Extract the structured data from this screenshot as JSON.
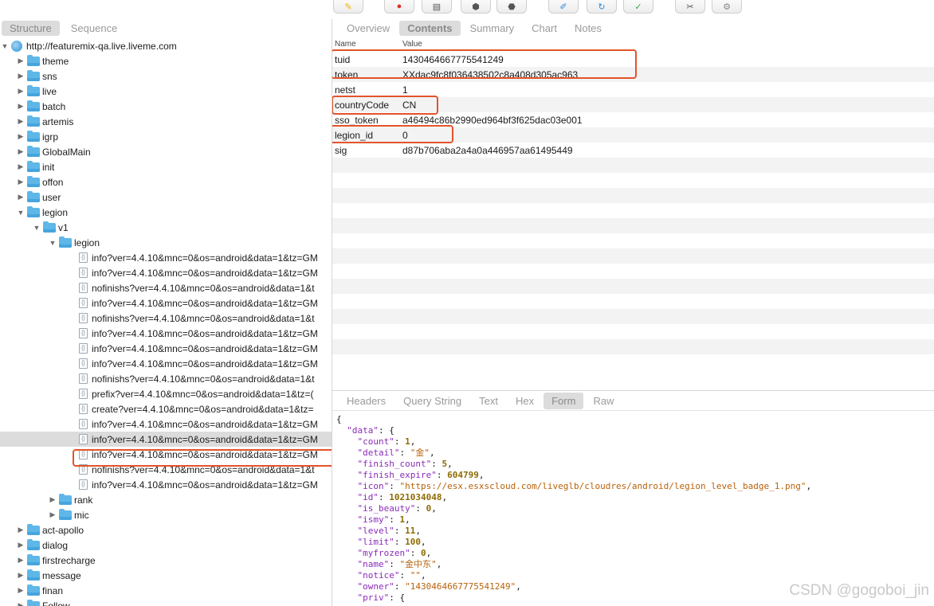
{
  "toolbar": {
    "buttons": [
      {
        "name": "highlight-tool",
        "glyph": "✎",
        "color": "#f2b300"
      },
      {
        "name": "record",
        "glyph": "●",
        "color": "#e0302a"
      },
      {
        "name": "throttle",
        "glyph": "▤",
        "color": "#555"
      },
      {
        "name": "breakpoints",
        "glyph": "⬢",
        "color": "#555"
      },
      {
        "name": "stop",
        "glyph": "⬣",
        "color": "#555"
      },
      {
        "name": "compose",
        "glyph": "✐",
        "color": "#2f8bd8"
      },
      {
        "name": "repeat",
        "glyph": "↻",
        "color": "#2f8bd8"
      },
      {
        "name": "validate",
        "glyph": "✓",
        "color": "#2fa84a"
      },
      {
        "name": "tools",
        "glyph": "✂",
        "color": "#555"
      },
      {
        "name": "settings",
        "glyph": "⚙",
        "color": "#888"
      }
    ]
  },
  "left": {
    "tabs": [
      "Structure",
      "Sequence"
    ],
    "host": "http://featuremix-qa.live.liveme.com",
    "tree": [
      {
        "label": "theme",
        "level": 1,
        "type": "folder",
        "open": false
      },
      {
        "label": "sns",
        "level": 1,
        "type": "folder",
        "open": false
      },
      {
        "label": "live",
        "level": 1,
        "type": "folder",
        "open": false
      },
      {
        "label": "batch",
        "level": 1,
        "type": "folder",
        "open": false
      },
      {
        "label": "artemis",
        "level": 1,
        "type": "folder",
        "open": false
      },
      {
        "label": "igrp",
        "level": 1,
        "type": "folder",
        "open": false
      },
      {
        "label": "GlobalMain",
        "level": 1,
        "type": "folder",
        "open": false
      },
      {
        "label": "init",
        "level": 1,
        "type": "folder",
        "open": false
      },
      {
        "label": "offon",
        "level": 1,
        "type": "folder",
        "open": false
      },
      {
        "label": "user",
        "level": 1,
        "type": "folder",
        "open": false
      },
      {
        "label": "legion",
        "level": 1,
        "type": "folder",
        "open": true
      },
      {
        "label": "v1",
        "level": 2,
        "type": "folder",
        "open": true
      },
      {
        "label": "legion",
        "level": 3,
        "type": "folder",
        "open": true
      },
      {
        "label": "info?ver=4.4.10&mnc=0&os=android&data=1&tz=GM",
        "level": 4,
        "type": "doc"
      },
      {
        "label": "info?ver=4.4.10&mnc=0&os=android&data=1&tz=GM",
        "level": 4,
        "type": "doc"
      },
      {
        "label": "nofinishs?ver=4.4.10&mnc=0&os=android&data=1&t",
        "level": 4,
        "type": "doc"
      },
      {
        "label": "info?ver=4.4.10&mnc=0&os=android&data=1&tz=GM",
        "level": 4,
        "type": "doc"
      },
      {
        "label": "nofinishs?ver=4.4.10&mnc=0&os=android&data=1&t",
        "level": 4,
        "type": "doc"
      },
      {
        "label": "info?ver=4.4.10&mnc=0&os=android&data=1&tz=GM",
        "level": 4,
        "type": "doc"
      },
      {
        "label": "info?ver=4.4.10&mnc=0&os=android&data=1&tz=GM",
        "level": 4,
        "type": "doc"
      },
      {
        "label": "info?ver=4.4.10&mnc=0&os=android&data=1&tz=GM",
        "level": 4,
        "type": "doc"
      },
      {
        "label": "nofinishs?ver=4.4.10&mnc=0&os=android&data=1&t",
        "level": 4,
        "type": "doc"
      },
      {
        "label": "prefix?ver=4.4.10&mnc=0&os=android&data=1&tz=(",
        "level": 4,
        "type": "doc"
      },
      {
        "label": "create?ver=4.4.10&mnc=0&os=android&data=1&tz=",
        "level": 4,
        "type": "doc"
      },
      {
        "label": "info?ver=4.4.10&mnc=0&os=android&data=1&tz=GM",
        "level": 4,
        "type": "doc"
      },
      {
        "label": "info?ver=4.4.10&mnc=0&os=android&data=1&tz=GM",
        "level": 4,
        "type": "doc",
        "selected": true
      },
      {
        "label": "info?ver=4.4.10&mnc=0&os=android&data=1&tz=GM",
        "level": 4,
        "type": "doc"
      },
      {
        "label": "nofinishs?ver=4.4.10&mnc=0&os=android&data=1&t",
        "level": 4,
        "type": "doc"
      },
      {
        "label": "info?ver=4.4.10&mnc=0&os=android&data=1&tz=GM",
        "level": 4,
        "type": "doc"
      },
      {
        "label": "rank",
        "level": 3,
        "type": "folder",
        "open": false
      },
      {
        "label": "mic",
        "level": 3,
        "type": "folder",
        "open": false
      },
      {
        "label": "act-apollo",
        "level": 1,
        "type": "folder",
        "open": false
      },
      {
        "label": "dialog",
        "level": 1,
        "type": "folder",
        "open": false
      },
      {
        "label": "firstrecharge",
        "level": 1,
        "type": "folder",
        "open": false
      },
      {
        "label": "message",
        "level": 1,
        "type": "folder",
        "open": false
      },
      {
        "label": "finan",
        "level": 1,
        "type": "folder",
        "open": false
      },
      {
        "label": "Follow",
        "level": 1,
        "type": "folder",
        "open": false
      }
    ]
  },
  "right": {
    "tabs": [
      "Overview",
      "Contents",
      "Summary",
      "Chart",
      "Notes"
    ],
    "active_tab": "Contents",
    "col_name": "Name",
    "col_value": "Value",
    "params": [
      {
        "key": "tuid",
        "value": "1430464667775541249"
      },
      {
        "key": "token",
        "value": "XXdac9fc8f036438502c8a408d305ac963"
      },
      {
        "key": "netst",
        "value": "1"
      },
      {
        "key": "countryCode",
        "value": "CN"
      },
      {
        "key": "sso_token",
        "value": "a46494c86b2990ed964bf3f625dac03e001"
      },
      {
        "key": "legion_id",
        "value": "0"
      },
      {
        "key": "sig",
        "value": "d87b706aba2a4a0a446957aa61495449"
      }
    ],
    "bottom_tabs": [
      "Headers",
      "Query String",
      "Text",
      "Hex",
      "Form",
      "Raw"
    ],
    "bottom_active": "Form",
    "json_lines": [
      {
        "indent": 0,
        "parts": [
          [
            "p",
            "{"
          ]
        ]
      },
      {
        "indent": 1,
        "parts": [
          [
            "k",
            "\"data\""
          ],
          [
            "p",
            ": {"
          ]
        ]
      },
      {
        "indent": 2,
        "parts": [
          [
            "k",
            "\"count\""
          ],
          [
            "p",
            ": "
          ],
          [
            "n",
            "1"
          ],
          [
            "p",
            ","
          ]
        ]
      },
      {
        "indent": 2,
        "parts": [
          [
            "k",
            "\"detail\""
          ],
          [
            "p",
            ": "
          ],
          [
            "s",
            "\"金\""
          ],
          [
            "p",
            ","
          ]
        ]
      },
      {
        "indent": 2,
        "parts": [
          [
            "k",
            "\"finish_count\""
          ],
          [
            "p",
            ": "
          ],
          [
            "n",
            "5"
          ],
          [
            "p",
            ","
          ]
        ]
      },
      {
        "indent": 2,
        "parts": [
          [
            "k",
            "\"finish_expire\""
          ],
          [
            "p",
            ": "
          ],
          [
            "n",
            "604799"
          ],
          [
            "p",
            ","
          ]
        ]
      },
      {
        "indent": 2,
        "parts": [
          [
            "k",
            "\"icon\""
          ],
          [
            "p",
            ": "
          ],
          [
            "s",
            "\"https://esx.esxscloud.com/liveglb/cloudres/android/legion_level_badge_1.png\""
          ],
          [
            "p",
            ","
          ]
        ]
      },
      {
        "indent": 2,
        "parts": [
          [
            "k",
            "\"id\""
          ],
          [
            "p",
            ": "
          ],
          [
            "n",
            "1021034048"
          ],
          [
            "p",
            ","
          ]
        ]
      },
      {
        "indent": 2,
        "parts": [
          [
            "k",
            "\"is_beauty\""
          ],
          [
            "p",
            ": "
          ],
          [
            "n",
            "0"
          ],
          [
            "p",
            ","
          ]
        ]
      },
      {
        "indent": 2,
        "parts": [
          [
            "k",
            "\"ismy\""
          ],
          [
            "p",
            ": "
          ],
          [
            "n",
            "1"
          ],
          [
            "p",
            ","
          ]
        ]
      },
      {
        "indent": 2,
        "parts": [
          [
            "k",
            "\"level\""
          ],
          [
            "p",
            ": "
          ],
          [
            "n",
            "11"
          ],
          [
            "p",
            ","
          ]
        ]
      },
      {
        "indent": 2,
        "parts": [
          [
            "k",
            "\"limit\""
          ],
          [
            "p",
            ": "
          ],
          [
            "n",
            "100"
          ],
          [
            "p",
            ","
          ]
        ]
      },
      {
        "indent": 2,
        "parts": [
          [
            "k",
            "\"myfrozen\""
          ],
          [
            "p",
            ": "
          ],
          [
            "n",
            "0"
          ],
          [
            "p",
            ","
          ]
        ]
      },
      {
        "indent": 2,
        "parts": [
          [
            "k",
            "\"name\""
          ],
          [
            "p",
            ": "
          ],
          [
            "s",
            "\"金中东\""
          ],
          [
            "p",
            ","
          ]
        ]
      },
      {
        "indent": 2,
        "parts": [
          [
            "k",
            "\"notice\""
          ],
          [
            "p",
            ": "
          ],
          [
            "s",
            "\"\""
          ],
          [
            "p",
            ","
          ]
        ]
      },
      {
        "indent": 2,
        "parts": [
          [
            "k",
            "\"owner\""
          ],
          [
            "p",
            ": "
          ],
          [
            "s",
            "\"1430464667775541249\""
          ],
          [
            "p",
            ","
          ]
        ]
      },
      {
        "indent": 2,
        "parts": [
          [
            "k",
            "\"priv\""
          ],
          [
            "p",
            ": {"
          ]
        ]
      }
    ]
  },
  "watermark": "CSDN @gogoboi_jin"
}
